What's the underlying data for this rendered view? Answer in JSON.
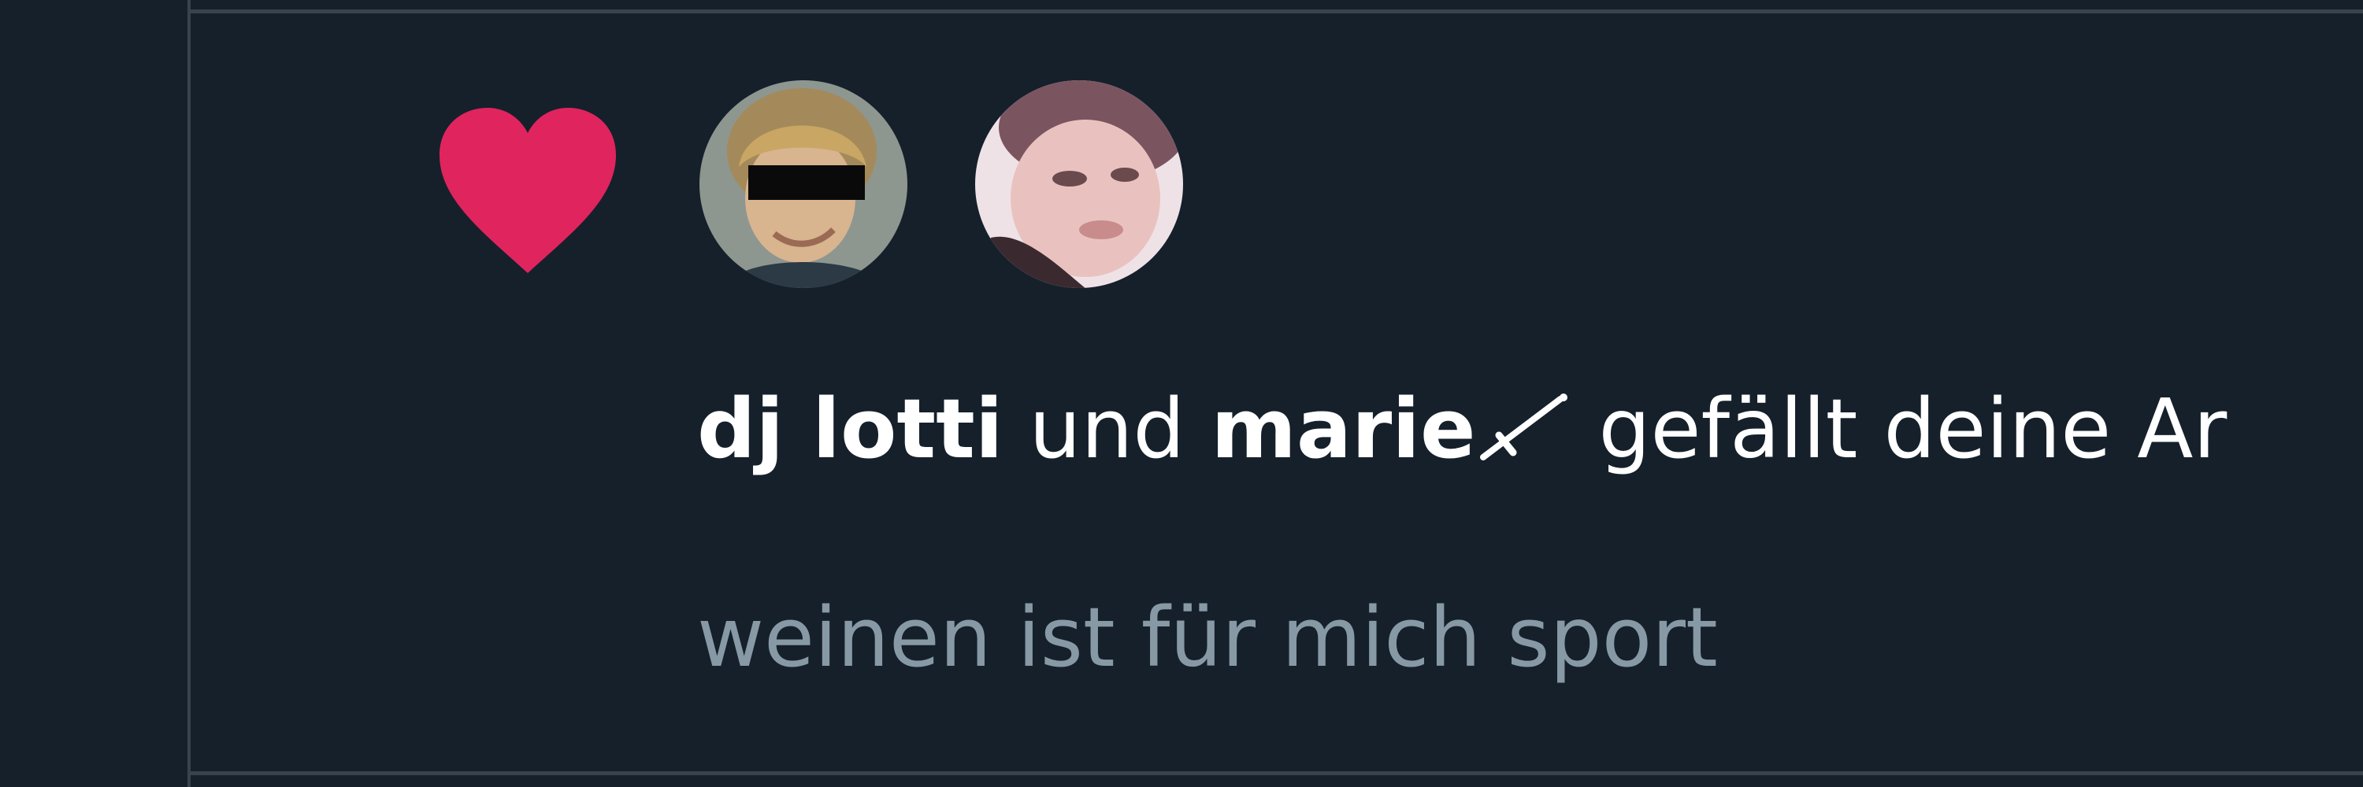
{
  "notification": {
    "type_icon": "heart-icon",
    "accent_color": "#e0245e",
    "avatars": [
      {
        "icon": "avatar-user-1"
      },
      {
        "icon": "avatar-user-2"
      }
    ],
    "user_1": "dj lotti",
    "conjunction": "und",
    "user_2": "marie",
    "user_2_badge_icon": "sword-icon",
    "action_text": "gefällt deine Ar",
    "tweet_preview": "weinen ist für mich sport"
  },
  "colors": {
    "background": "#15202b",
    "divider": "#38444d",
    "primary_text": "#ffffff",
    "secondary_text": "#8899a6"
  }
}
